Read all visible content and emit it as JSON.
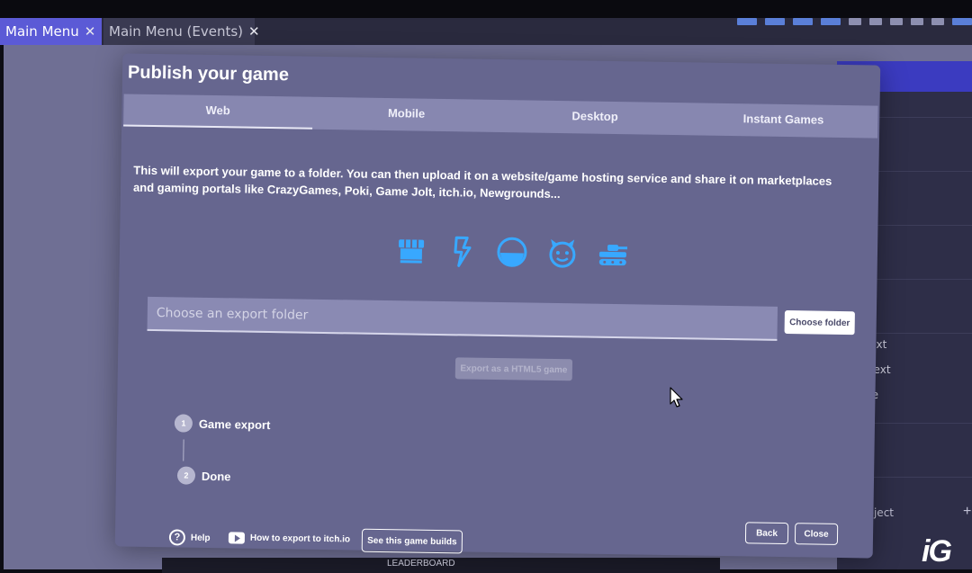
{
  "tabs": [
    {
      "label": "Main Menu",
      "close": "✕"
    },
    {
      "label": "Main Menu (Events)",
      "close": "✕"
    }
  ],
  "right_panel": {
    "items": [
      "_Text",
      "s_Text",
      "hite"
    ],
    "new_object": "ew object",
    "plus": "+"
  },
  "bottom_bar": {
    "text1": "",
    "text2": "LEADERBOARD"
  },
  "logo": "iG",
  "dialog": {
    "title": "Publish your game",
    "tabs": [
      "Web",
      "Mobile",
      "Desktop",
      "Instant Games"
    ],
    "selected_tab": "Web",
    "description": "This will export your game to a folder. You can then upload it on a website/game hosting service and share it on marketplaces and gaming portals like CrazyGames, Poki, Game Jolt, itch.io, Newgrounds...",
    "platform_icons": [
      "shop-icon",
      "lightning-icon",
      "half-circle-icon",
      "devil-face-icon",
      "tank-icon"
    ],
    "icon_color": "#38a8ff",
    "folder_placeholder": "Choose an export folder",
    "folder_value": "",
    "choose_folder": "Choose folder",
    "export_button": "Export as a HTML5 game",
    "steps": [
      {
        "number": "1",
        "label": "Game export"
      },
      {
        "number": "2",
        "label": "Done"
      }
    ],
    "footer": {
      "help": "Help",
      "how_to_export": "How to export to itch.io",
      "see_builds": "See this game builds",
      "back": "Back",
      "close": "Close"
    }
  }
}
